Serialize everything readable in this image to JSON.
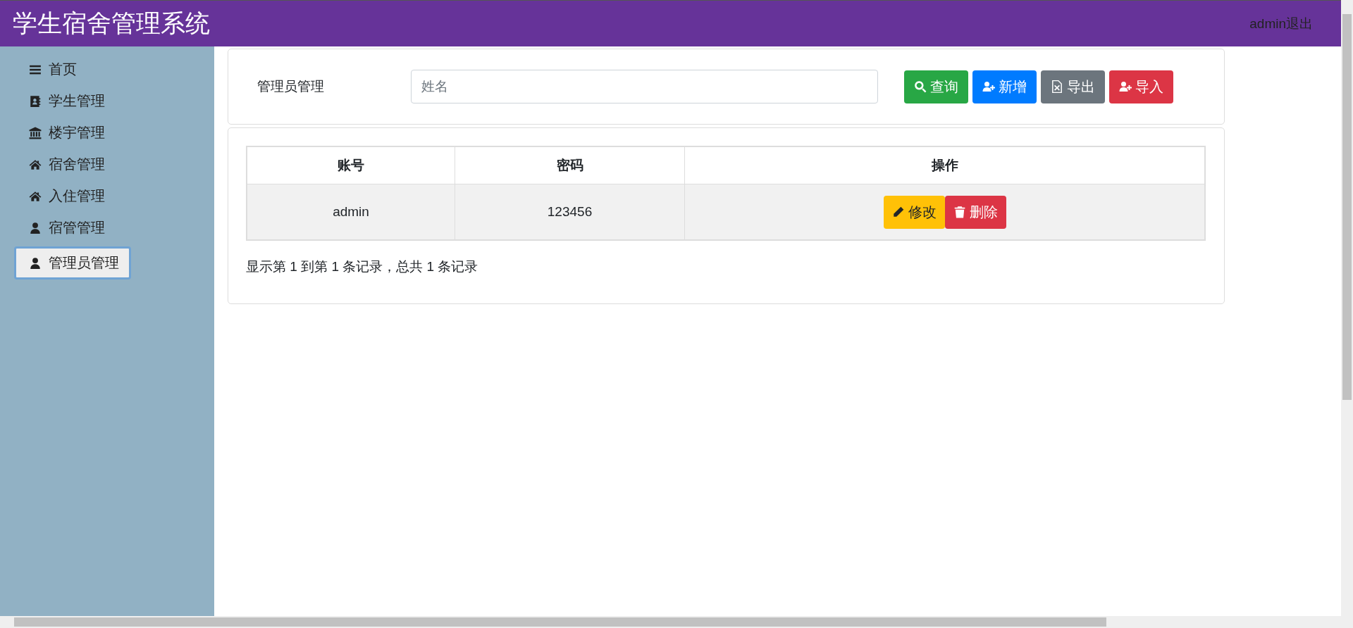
{
  "header": {
    "title": "学生宿舍管理系统",
    "user_link": "admin退出"
  },
  "sidebar": {
    "items": [
      {
        "label": "首页",
        "selected": false
      },
      {
        "label": "学生管理",
        "selected": false
      },
      {
        "label": "楼宇管理",
        "selected": false
      },
      {
        "label": "宿舍管理",
        "selected": false
      },
      {
        "label": "入住管理",
        "selected": false
      },
      {
        "label": "宿管管理",
        "selected": false
      },
      {
        "label": "管理员管理",
        "selected": true
      }
    ]
  },
  "search_panel": {
    "title": "管理员管理",
    "search": {
      "placeholder": "姓名"
    },
    "buttons": [
      {
        "label": "查询",
        "kind": "success"
      },
      {
        "label": "新增",
        "kind": "primary"
      },
      {
        "label": "导出",
        "kind": "secondary"
      },
      {
        "label": "导入",
        "kind": "danger"
      }
    ]
  },
  "table": {
    "columns": [
      "账号",
      "密码",
      "操作"
    ],
    "rows": [
      {
        "cells": [
          "admin",
          "123456"
        ],
        "actions": [
          {
            "label": "修改",
            "kind": "warning"
          },
          {
            "label": "删除",
            "kind": "danger"
          }
        ]
      }
    ]
  },
  "pagination_info": "显示第 1 到第 1 条记录，总共 1 条记录"
}
